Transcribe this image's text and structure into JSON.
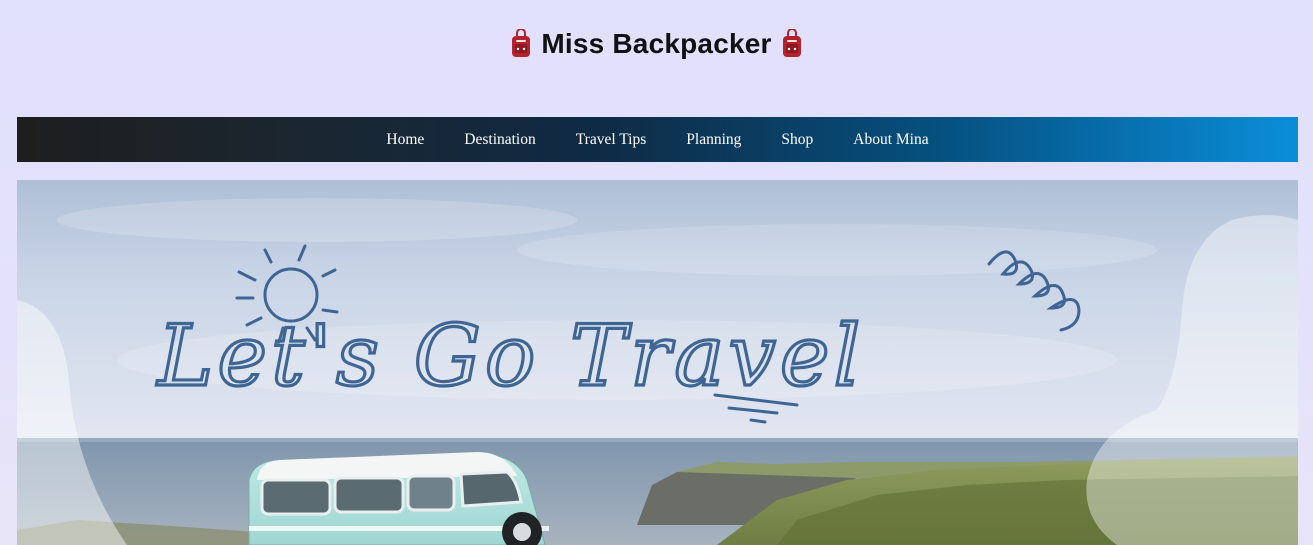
{
  "site": {
    "title": "Miss Backpacker",
    "title_icon": "backpack-icon",
    "icon_color": "#b3232b"
  },
  "nav": {
    "items": [
      {
        "label": "Home"
      },
      {
        "label": "Destination"
      },
      {
        "label": "Travel Tips"
      },
      {
        "label": "Planning"
      },
      {
        "label": "Shop"
      },
      {
        "label": "About Mina"
      }
    ]
  },
  "hero": {
    "headline": "Let's Go Travel",
    "headline_color": "#3e6594",
    "decorations": [
      "sun-icon",
      "swirl-icon",
      "underline-strokes"
    ],
    "scene": [
      "sky",
      "ocean",
      "cliffs",
      "grass",
      "camper-van"
    ]
  }
}
